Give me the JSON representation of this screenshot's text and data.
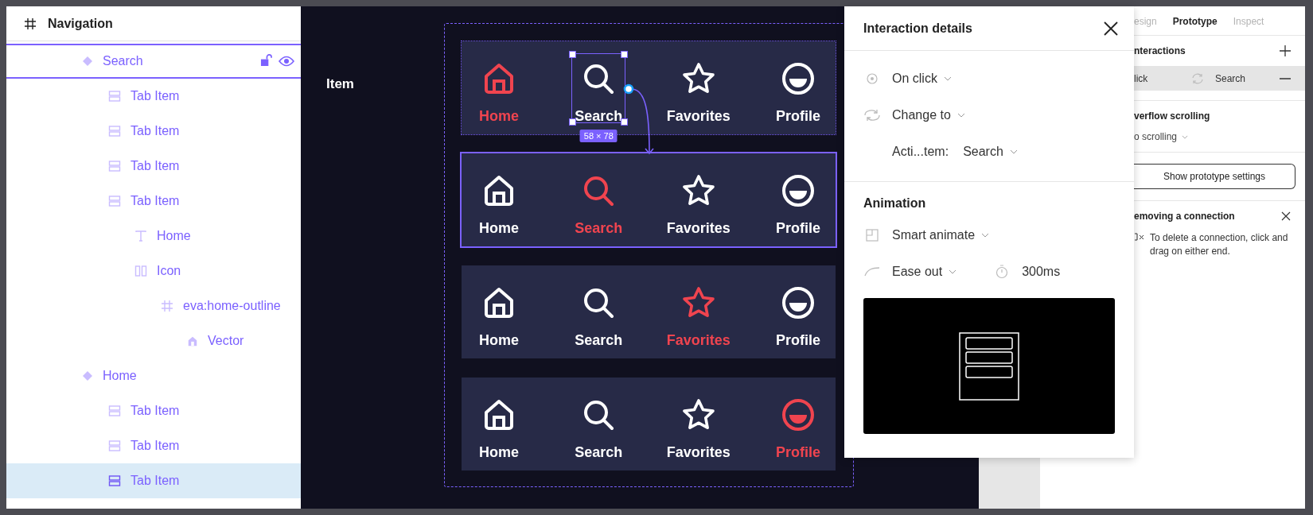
{
  "layers_panel": {
    "header": "Navigation",
    "layers": [
      {
        "name": "Search",
        "kind": "instance",
        "selected": false,
        "hovered": true,
        "children": [
          {
            "name": "Tab Item",
            "kind": "autolayout",
            "selected": false,
            "hovered": false
          },
          {
            "name": "Tab Item",
            "kind": "autolayout",
            "selected": false,
            "hovered": false
          },
          {
            "name": "Tab Item",
            "kind": "autolayout",
            "selected": false,
            "hovered": false
          },
          {
            "name": "Tab Item",
            "kind": "autolayout",
            "selected": false,
            "hovered": false,
            "children": [
              {
                "name": "Home",
                "kind": "text",
                "selected": false,
                "hovered": false
              },
              {
                "name": "Icon",
                "kind": "columns",
                "selected": false,
                "hovered": false,
                "children": [
                  {
                    "name": "eva:home-outline",
                    "kind": "frame",
                    "selected": false,
                    "hovered": false,
                    "children": [
                      {
                        "name": "Vector",
                        "kind": "vector",
                        "selected": false,
                        "hovered": false
                      }
                    ]
                  }
                ]
              }
            ]
          }
        ]
      },
      {
        "name": "Home",
        "kind": "instance",
        "selected": false,
        "hovered": false,
        "children": [
          {
            "name": "Tab Item",
            "kind": "autolayout",
            "selected": false,
            "hovered": false
          },
          {
            "name": "Tab Item",
            "kind": "autolayout",
            "selected": false,
            "hovered": false
          },
          {
            "name": "Tab Item",
            "kind": "autolayout",
            "selected": true,
            "hovered": false
          }
        ]
      }
    ]
  },
  "canvas": {
    "frame_label": "Item",
    "bars": [
      {
        "kind": "selected",
        "frame_size": "58 × 78",
        "items": [
          {
            "label": "Home",
            "kind": "home",
            "selected": true,
            "framed": false
          },
          {
            "label": "Search",
            "kind": "search",
            "selected": false,
            "framed": true
          },
          {
            "label": "Favorites",
            "kind": "star",
            "selected": false,
            "framed": false
          },
          {
            "label": "Profile",
            "kind": "profile",
            "selected": false,
            "framed": false
          }
        ]
      },
      {
        "kind": "target",
        "items": [
          {
            "label": "Home",
            "kind": "home",
            "selected": false
          },
          {
            "label": "Search",
            "kind": "search",
            "selected": true
          },
          {
            "label": "Favorites",
            "kind": "star",
            "selected": false
          },
          {
            "label": "Profile",
            "kind": "profile",
            "selected": false
          }
        ]
      },
      {
        "kind": "plain",
        "items": [
          {
            "label": "Home",
            "kind": "home",
            "selected": false
          },
          {
            "label": "Search",
            "kind": "search",
            "selected": false
          },
          {
            "label": "Favorites",
            "kind": "star",
            "selected": true
          },
          {
            "label": "Profile",
            "kind": "profile",
            "selected": false
          }
        ]
      },
      {
        "kind": "plain",
        "items": [
          {
            "label": "Home",
            "kind": "home",
            "selected": false
          },
          {
            "label": "Search",
            "kind": "search",
            "selected": false
          },
          {
            "label": "Favorites",
            "kind": "star",
            "selected": false
          },
          {
            "label": "Profile",
            "kind": "profile",
            "selected": true
          }
        ]
      }
    ]
  },
  "interaction_details": {
    "title": "Interaction details",
    "trigger": "On click",
    "action": "Change to",
    "destination_label": "Acti...tem:",
    "destination": "Search",
    "animation_heading": "Animation",
    "animation": "Smart animate",
    "easing": "Ease out",
    "duration": "300ms"
  },
  "properties_panel": {
    "tabs": [
      {
        "label": "esign",
        "selected": false
      },
      {
        "label": "Prototype",
        "selected": true
      },
      {
        "label": "Inspect",
        "selected": false
      }
    ],
    "interactions_heading": "nteractions",
    "interactions": [
      {
        "trigger": "lick",
        "destination": "Search"
      }
    ],
    "overflow_heading": "verflow scrolling",
    "overflow_value": "o scrolling",
    "settings_button": "Show prototype settings",
    "hint_title": "emoving a connection",
    "hint_text": "To delete a connection, click and drag on either end."
  }
}
